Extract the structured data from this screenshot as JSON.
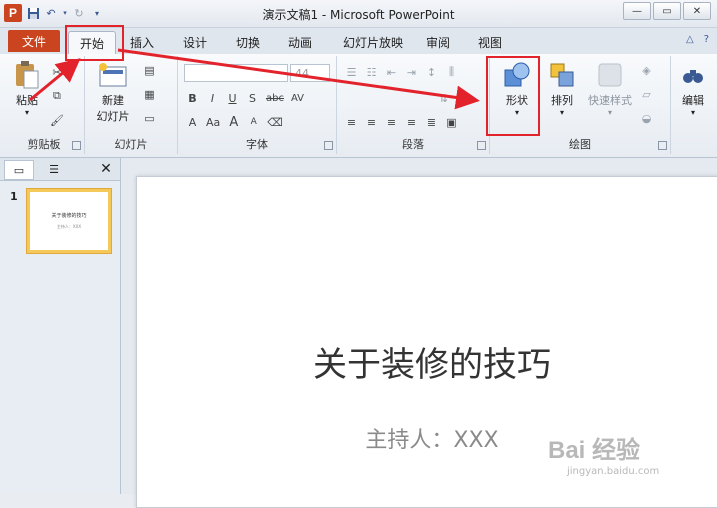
{
  "window": {
    "title": "演示文稿1 - Microsoft PowerPoint",
    "app_logo": "P",
    "min": "—",
    "restore": "▭",
    "close": "✕"
  },
  "tabs": {
    "file": "文件",
    "items": [
      "开始",
      "插入",
      "设计",
      "切换",
      "动画",
      "幻灯片放映",
      "审阅",
      "视图"
    ],
    "active": "开始"
  },
  "ribbon": {
    "clipboard": {
      "paste": "粘贴",
      "label": "剪贴板"
    },
    "slides": {
      "new_slide": "新建",
      "new_slide2": "幻灯片",
      "label": "幻灯片"
    },
    "font": {
      "size": "44",
      "bold": "B",
      "italic": "I",
      "underline": "U",
      "shadow": "S",
      "strike": "abc",
      "spacing": "AV",
      "grow": "A",
      "shrink": "A",
      "clear": "Aa",
      "label": "字体"
    },
    "paragraph": {
      "label": "段落"
    },
    "drawing": {
      "shapes": "形状",
      "arrange": "排列",
      "quick_styles": "快速样式",
      "label": "绘图"
    },
    "editing": {
      "label": "编辑"
    }
  },
  "panel": {
    "slide_number": "1",
    "thumb_title": "关于装修的技巧",
    "thumb_sub": "主持人：XXX"
  },
  "slide": {
    "title": "关于装修的技巧",
    "subtitle": "主持人：XXX"
  },
  "watermark": {
    "brand": "Bai 经验",
    "url": "jingyan.baidu.com"
  },
  "colors": {
    "accent_red": "#e3232b",
    "file_tab": "#c9441f"
  }
}
